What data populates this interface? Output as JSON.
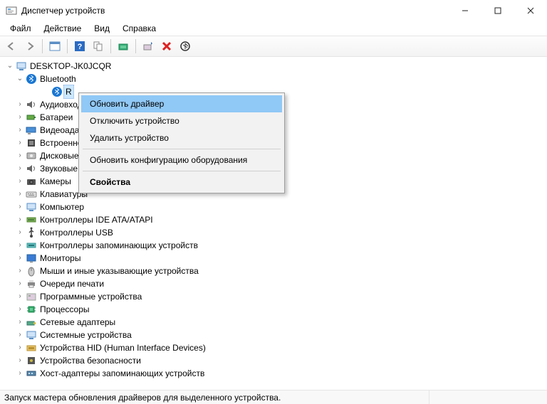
{
  "window": {
    "title": "Диспетчер устройств"
  },
  "menu": {
    "file": "Файл",
    "action": "Действие",
    "view": "Вид",
    "help": "Справка"
  },
  "computer_name": "DESKTOP-JK0JCQR",
  "tree": {
    "bluetooth": "Bluetooth",
    "bluetooth_device_prefix": "R",
    "audio": "Аудиовходы и аудиовыходы",
    "batteries": "Батареи",
    "video": "Видеоадаптеры",
    "firmware": "Встроенное ПО",
    "disks": "Дисковые устройства",
    "sound": "Звуковые, игровые и видеоустройства",
    "cameras": "Камеры",
    "keyboards": "Клавиатуры",
    "computer": "Компьютер",
    "ide": "Контроллеры IDE ATA/ATAPI",
    "usb": "Контроллеры USB",
    "storage_ctrl": "Контроллеры запоминающих устройств",
    "monitors": "Мониторы",
    "mice": "Мыши и иные указывающие устройства",
    "printq": "Очереди печати",
    "swdev": "Программные устройства",
    "cpu": "Процессоры",
    "netadapt": "Сетевые адаптеры",
    "sysdev": "Системные устройства",
    "hid": "Устройства HID (Human Interface Devices)",
    "security": "Устройства безопасности",
    "hba": "Хост-адаптеры запоминающих устройств"
  },
  "context_menu": {
    "update_driver": "Обновить драйвер",
    "disable_device": "Отключить устройство",
    "uninstall_device": "Удалить устройство",
    "scan_hw": "Обновить конфигурацию оборудования",
    "properties": "Свойства"
  },
  "statusbar": "Запуск мастера обновления драйверов для выделенного устройства."
}
